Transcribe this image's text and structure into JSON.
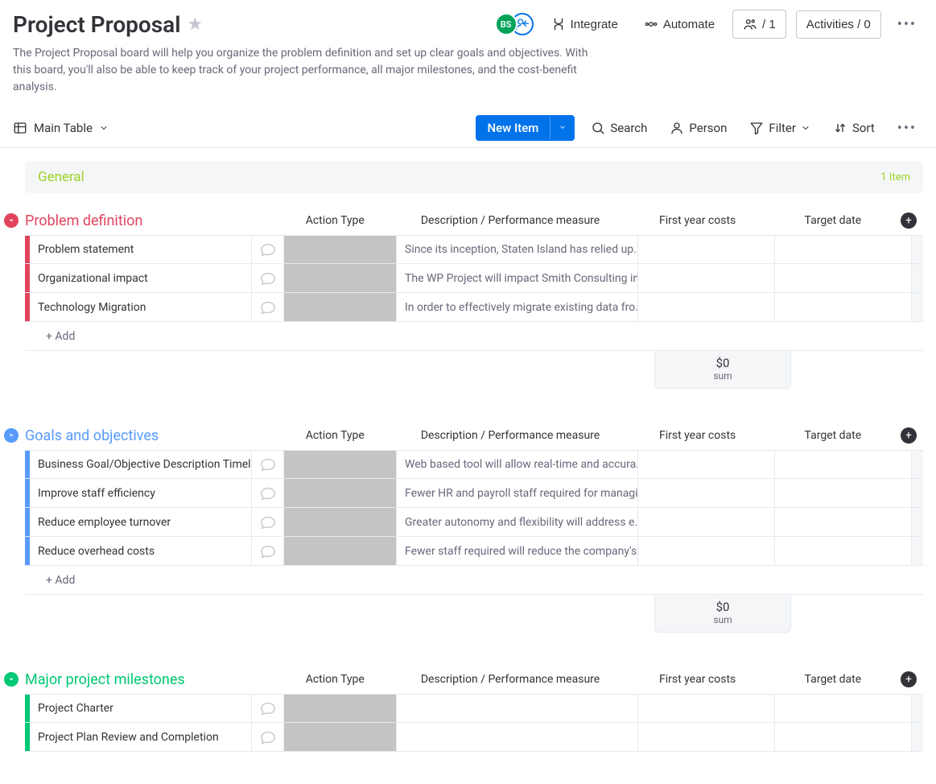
{
  "header": {
    "title": "Project Proposal",
    "avatar_initials": "BS",
    "integrate": "Integrate",
    "automate": "Automate",
    "members_count": "/ 1",
    "activities": "Activities / 0"
  },
  "description": "The Project Proposal board will help you organize the problem definition and set up clear goals and objectives. With this board, you'll also be able to keep track of your project performance, all major milestones, and the cost-benefit analysis.",
  "toolbar": {
    "view": "Main Table",
    "new_item": "New Item",
    "search": "Search",
    "person": "Person",
    "filter": "Filter",
    "sort": "Sort"
  },
  "general": {
    "label": "General",
    "count": "1 Item"
  },
  "columns": {
    "action": "Action Type",
    "desc": "Description / Performance measure",
    "cost": "First year costs",
    "date": "Target date"
  },
  "groups": [
    {
      "title": "Problem definition",
      "color": "#e2445c",
      "light": "#f4a1ad",
      "sum": "$0",
      "sum_label": "sum",
      "items": [
        {
          "name": "Problem statement",
          "desc": "Since its inception, Staten Island has relied up..."
        },
        {
          "name": "Organizational impact",
          "desc": "The WP Project will impact Smith Consulting in..."
        },
        {
          "name": "Technology Migration",
          "desc": "In order to effectively migrate existing data fro..."
        }
      ],
      "add": "+ Add"
    },
    {
      "title": "Goals and objectives",
      "color": "#579bfc",
      "light": "#abcdfe",
      "sum": "$0",
      "sum_label": "sum",
      "items": [
        {
          "name": "Business Goal/Objective Description Timely a...",
          "desc": "Web based tool will allow real-time and accura..."
        },
        {
          "name": "Improve staff efficiency",
          "desc": "Fewer HR and payroll staff required for managi..."
        },
        {
          "name": "Reduce employee turnover",
          "desc": "Greater autonomy and flexibility will address e..."
        },
        {
          "name": "Reduce overhead costs",
          "desc": "Fewer staff required will reduce the company's..."
        }
      ],
      "add": "+ Add"
    },
    {
      "title": "Major project milestones",
      "color": "#00c875",
      "light": "#80e4ba",
      "items": [
        {
          "name": "Project Charter",
          "desc": ""
        },
        {
          "name": "Project Plan Review and Completion",
          "desc": ""
        }
      ]
    }
  ]
}
